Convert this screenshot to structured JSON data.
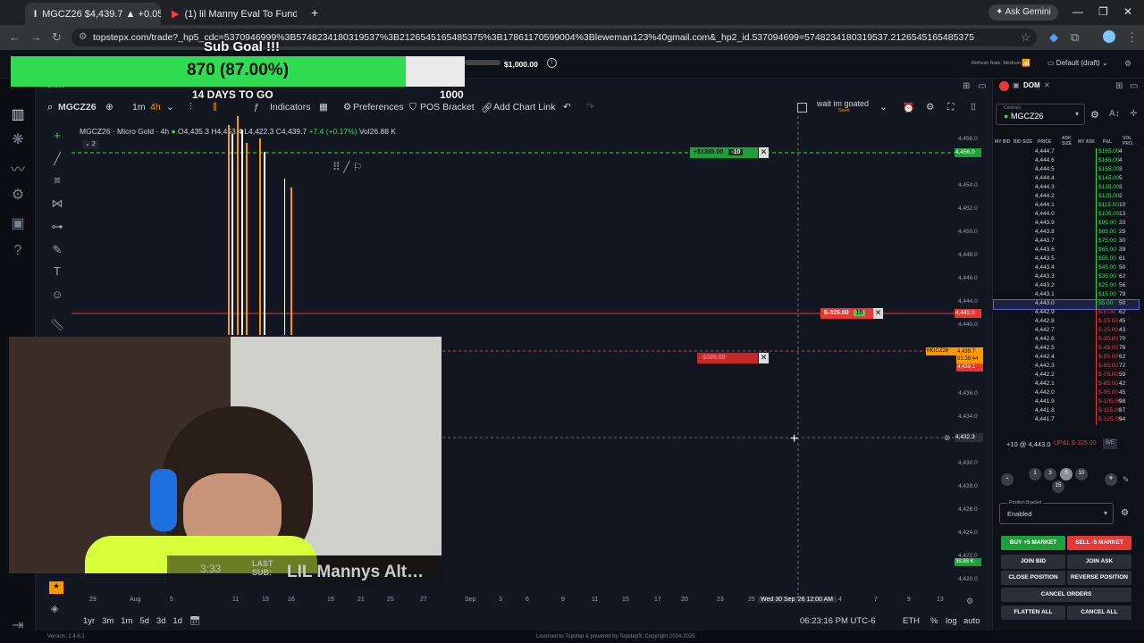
{
  "browser": {
    "tabs": [
      {
        "label": "MGCZ26 $4,439.7 ▲ +0.05%",
        "active": true
      },
      {
        "label": "(1) lil Manny Eval To Funded LI…",
        "active": false
      }
    ],
    "new_tab": "+",
    "ask_gemini": "Ask Gemini",
    "url": "topstepx.com/trade?_hp5_cdc=5370946999%3B5748234180319537%3B2126545165485375%3B17861170599004%3Bleweman123%40gmail.com&_hp2_id.537094699=5748234180319537.2126545165485375"
  },
  "overlay": {
    "title": "Sub Goal !!!",
    "progress_text": "870 (87.00%)",
    "progress_fraction": 0.87,
    "days": "14 DAYS TO GO",
    "max": "1000",
    "last_sub_time": "3:33",
    "last_sub_label1": "LAST",
    "last_sub_label2": "SUB:",
    "last_sub_name": "LIL Mannys Alt…"
  },
  "apptop": {
    "balance_left": "0",
    "balance": "$1,000.00",
    "refresh": "Refresh Rate: Medium",
    "layout": "Default (draft)"
  },
  "chart": {
    "tab_label": "Chart",
    "symbol": "MGCZ26",
    "interval_1m": "1m",
    "interval_4h": "4h",
    "indicators": "Indicators",
    "preferences": "Preferences",
    "pos_bracket": "POS Bracket",
    "add_chart_link": "Add Chart Link",
    "layout_name": "wait im goated",
    "layout_save": "Save",
    "legend_title": "MGCZ26 · Micro Gold · 4h",
    "legend_o": "O4,435.3",
    "legend_h": "H4,453.4",
    "legend_l": "L4,422.3",
    "legend_c": "C4,439.7",
    "legend_chg": "+7.4 (+0.17%)",
    "legend_vol": "Vol26.88 K",
    "legend_count": "2",
    "price_axis": [
      "4,458.0",
      "4,456.0",
      "4,454.0",
      "4,452.0",
      "4,450.0",
      "4,448.0",
      "4,446.0",
      "4,444.0",
      "4,442.0",
      "4,440.0",
      "4,438.0",
      "4,436.0",
      "4,434.0",
      "4,432.3",
      "4,430.0",
      "4,428.0",
      "4,426.0",
      "4,424.0",
      "4,422.0",
      "4,420.0"
    ],
    "tp_order": "+$1385.00",
    "tp_qty": "-10",
    "sl_order": "$-325.00",
    "sl_qty": "10",
    "cancel_order": "-$385.00",
    "current_tag": "MGCZ26",
    "current_price": "4,439.7",
    "current_timer": "01:38:44",
    "current_red": "4,439.1",
    "crosshair_price": "4,432.3",
    "bottom_price": "38.88 K",
    "time_axis": [
      "29",
      "Aug",
      "5",
      "11",
      "13",
      "16",
      "19",
      "21",
      "25",
      "27",
      "Sep",
      "3",
      "6",
      "9",
      "11",
      "15",
      "17",
      "20",
      "23",
      "25",
      "Wed 30 Sep '26",
      "12:00 AM",
      "4",
      "7",
      "9",
      "13"
    ],
    "ranges": [
      "1yr",
      "3m",
      "1m",
      "5d",
      "3d",
      "1d"
    ],
    "clock": "06:23:16 PM UTC-6",
    "session": "ETH",
    "pct": "%",
    "log": "log",
    "auto": "auto"
  },
  "dom": {
    "title": "DOM",
    "contract_label": "Contract",
    "contract": "MGCZ26",
    "headers": [
      "MY BID",
      "BID SIZE",
      "PRICE",
      "ASK SIZE",
      "MY ASK",
      "P&L",
      "VOL PRO."
    ],
    "rows": [
      {
        "price": "4,444.7",
        "pnl": "$165.00",
        "vol": "4"
      },
      {
        "price": "4,444.6",
        "pnl": "$165.00",
        "vol": "4"
      },
      {
        "price": "4,444.5",
        "pnl": "$155.00",
        "vol": "3"
      },
      {
        "price": "4,444.4",
        "pnl": "$145.00",
        "vol": "5"
      },
      {
        "price": "4,444.3",
        "pnl": "$135.00",
        "vol": "3"
      },
      {
        "price": "4,444.2",
        "pnl": "$125.00",
        "vol": "2"
      },
      {
        "price": "4,444.1",
        "pnl": "$115.00",
        "vol": "10"
      },
      {
        "price": "4,444.0",
        "pnl": "$105.00",
        "vol": "13"
      },
      {
        "price": "4,443.9",
        "pnl": "$95.00",
        "vol": "20"
      },
      {
        "price": "4,443.8",
        "pnl": "$85.00",
        "vol": "29"
      },
      {
        "price": "4,443.7",
        "pnl": "$75.00",
        "vol": "30"
      },
      {
        "price": "4,443.6",
        "pnl": "$65.00",
        "vol": "39"
      },
      {
        "price": "4,443.5",
        "pnl": "$55.00",
        "vol": "61"
      },
      {
        "price": "4,443.4",
        "pnl": "$45.00",
        "vol": "50"
      },
      {
        "price": "4,443.3",
        "pnl": "$35.00",
        "vol": "62"
      },
      {
        "price": "4,443.2",
        "pnl": "$25.00",
        "vol": "56"
      },
      {
        "price": "4,443.1",
        "pnl": "$15.00",
        "vol": "79"
      },
      {
        "price": "4,443.0",
        "pnl": "$5.00",
        "vol": "50",
        "current": true
      },
      {
        "price": "4,442.9",
        "pnl": "$-5.00",
        "vol": "62"
      },
      {
        "price": "4,442.8",
        "pnl": "$-15.00",
        "vol": "45"
      },
      {
        "price": "4,442.7",
        "pnl": "$-25.00",
        "vol": "43"
      },
      {
        "price": "4,442.6",
        "pnl": "$-35.00",
        "vol": "70"
      },
      {
        "price": "4,442.5",
        "pnl": "$-45.00",
        "vol": "76"
      },
      {
        "price": "4,442.4",
        "pnl": "$-55.00",
        "vol": "62"
      },
      {
        "price": "4,442.3",
        "pnl": "$-65.00",
        "vol": "72"
      },
      {
        "price": "4,442.2",
        "pnl": "$-75.00",
        "vol": "59"
      },
      {
        "price": "4,442.1",
        "pnl": "$-85.00",
        "vol": "42"
      },
      {
        "price": "4,442.0",
        "pnl": "$-95.00",
        "vol": "45"
      },
      {
        "price": "4,441.9",
        "pnl": "$-105.00",
        "vol": "98"
      },
      {
        "price": "4,441.8",
        "pnl": "$-115.00",
        "vol": "87"
      },
      {
        "price": "4,441.7",
        "pnl": "$-125.00",
        "vol": "94"
      }
    ],
    "position": "+10 @ 4,443.0",
    "upl": "UP&L $-325.00",
    "be": "B/E",
    "qty_buttons": [
      "1",
      "3",
      "5",
      "10",
      "15"
    ],
    "bracket_label": "Position Bracket",
    "bracket_value": "Enabled",
    "buy_market": "BUY +5 MARKET",
    "sell_market": "SELL -5 MARKET",
    "join_bid": "JOIN BID",
    "join_ask": "JOIN ASK",
    "close_position": "CLOSE POSITION",
    "reverse_position": "REVERSE POSITION",
    "cancel_orders": "CANCEL ORDERS",
    "flatten_all": "FLATTEN ALL",
    "cancel_all": "CANCEL ALL"
  },
  "status": {
    "version": "Version: 2.4.6.1",
    "license": "Licensed to Topstep & powered by TopstepX. Copyright 2024-2025"
  },
  "colors": {
    "green": "#2fdc52",
    "red": "#e53935",
    "bg": "#131722"
  }
}
